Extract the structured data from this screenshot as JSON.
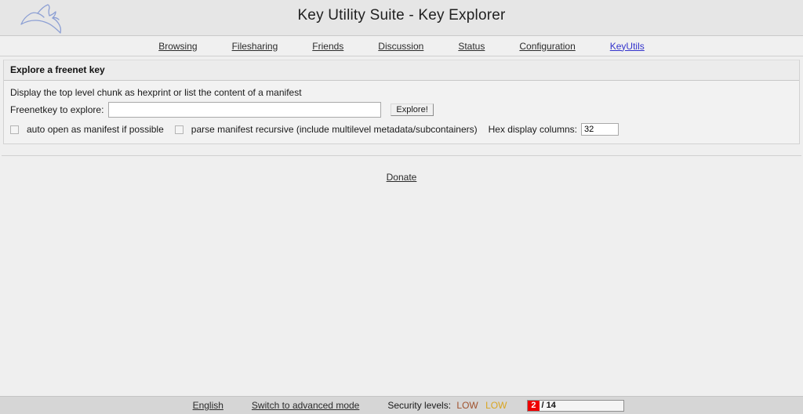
{
  "header": {
    "title": "Key Utility Suite - Key Explorer",
    "logo_icon": "freenet-rabbit-logo"
  },
  "nav": {
    "items": [
      {
        "label": "Browsing",
        "active": false
      },
      {
        "label": "Filesharing",
        "active": false
      },
      {
        "label": "Friends",
        "active": false
      },
      {
        "label": "Discussion",
        "active": false
      },
      {
        "label": "Status",
        "active": false
      },
      {
        "label": "Configuration",
        "active": false
      },
      {
        "label": "KeyUtils",
        "active": true
      }
    ]
  },
  "panel": {
    "header_title": "Explore a freenet key",
    "description": "Display the top level chunk as hexprint or list the content of a manifest",
    "key_field_label": "Freenetkey to explore:",
    "key_field_value": "",
    "explore_button_label": "Explore!",
    "option_auto_open_label": "auto open as manifest if possible",
    "option_recursive_label": "parse manifest recursive (include multilevel metadata/subcontainers)",
    "hex_columns_label": "Hex display columns:",
    "hex_columns_value": "32"
  },
  "donate": {
    "label": "Donate"
  },
  "footer": {
    "language_label": "English",
    "mode_switch_label": "Switch to advanced mode",
    "security_levels_label": "Security levels:",
    "security_level_network": "LOW",
    "security_level_physical": "LOW",
    "peers_connected": "2",
    "peers_total": "/ 14"
  },
  "colors": {
    "accent_link": "#3333cc",
    "peer_alert": "#ee0000",
    "security_network": "#a0522d",
    "security_physical": "#d9a520",
    "header_bg": "#e6e6e6",
    "footer_bg": "#d6d6d6",
    "page_bg": "#efefef"
  }
}
